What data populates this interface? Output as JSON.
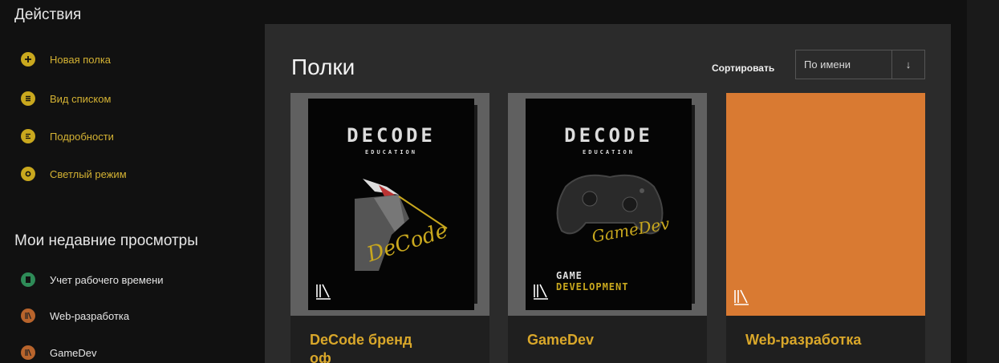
{
  "sidebar": {
    "actions_title": "Действия",
    "actions": [
      {
        "label": "Новая полка",
        "icon": "plus-icon"
      },
      {
        "label": "Вид списком",
        "icon": "list-icon"
      },
      {
        "label": "Подробности",
        "icon": "details-icon"
      },
      {
        "label": "Светлый режим",
        "icon": "sun-icon"
      }
    ],
    "recent_title": "Мои недавние просмотры",
    "recent": [
      {
        "label": "Учет рабочего времени",
        "icon": "book-icon"
      },
      {
        "label": "Web-разработка",
        "icon": "shelf-icon"
      },
      {
        "label": "GameDev",
        "icon": "shelf-icon"
      }
    ]
  },
  "main": {
    "title": "Полки",
    "sort_label": "Сортировать",
    "sort_value": "По имени",
    "sort_direction": "↓",
    "cards": [
      {
        "title": "DeCode бренд",
        "title_cont": "оф",
        "logo": "DECODE",
        "subtitle": "EDUCATION",
        "signature": "DeCode"
      },
      {
        "title": "GameDev",
        "logo": "DECODE",
        "subtitle": "EDUCATION",
        "tag1": "GAME",
        "tag2": "DEVELOPMENT",
        "signature": "GameDev"
      },
      {
        "title": "Web-разработка"
      }
    ]
  },
  "colors": {
    "accent": "#d9a72a",
    "sidebar_icon": "#c9a81e",
    "orange_cover": "#d97a32",
    "panel": "#2b2b2b"
  }
}
